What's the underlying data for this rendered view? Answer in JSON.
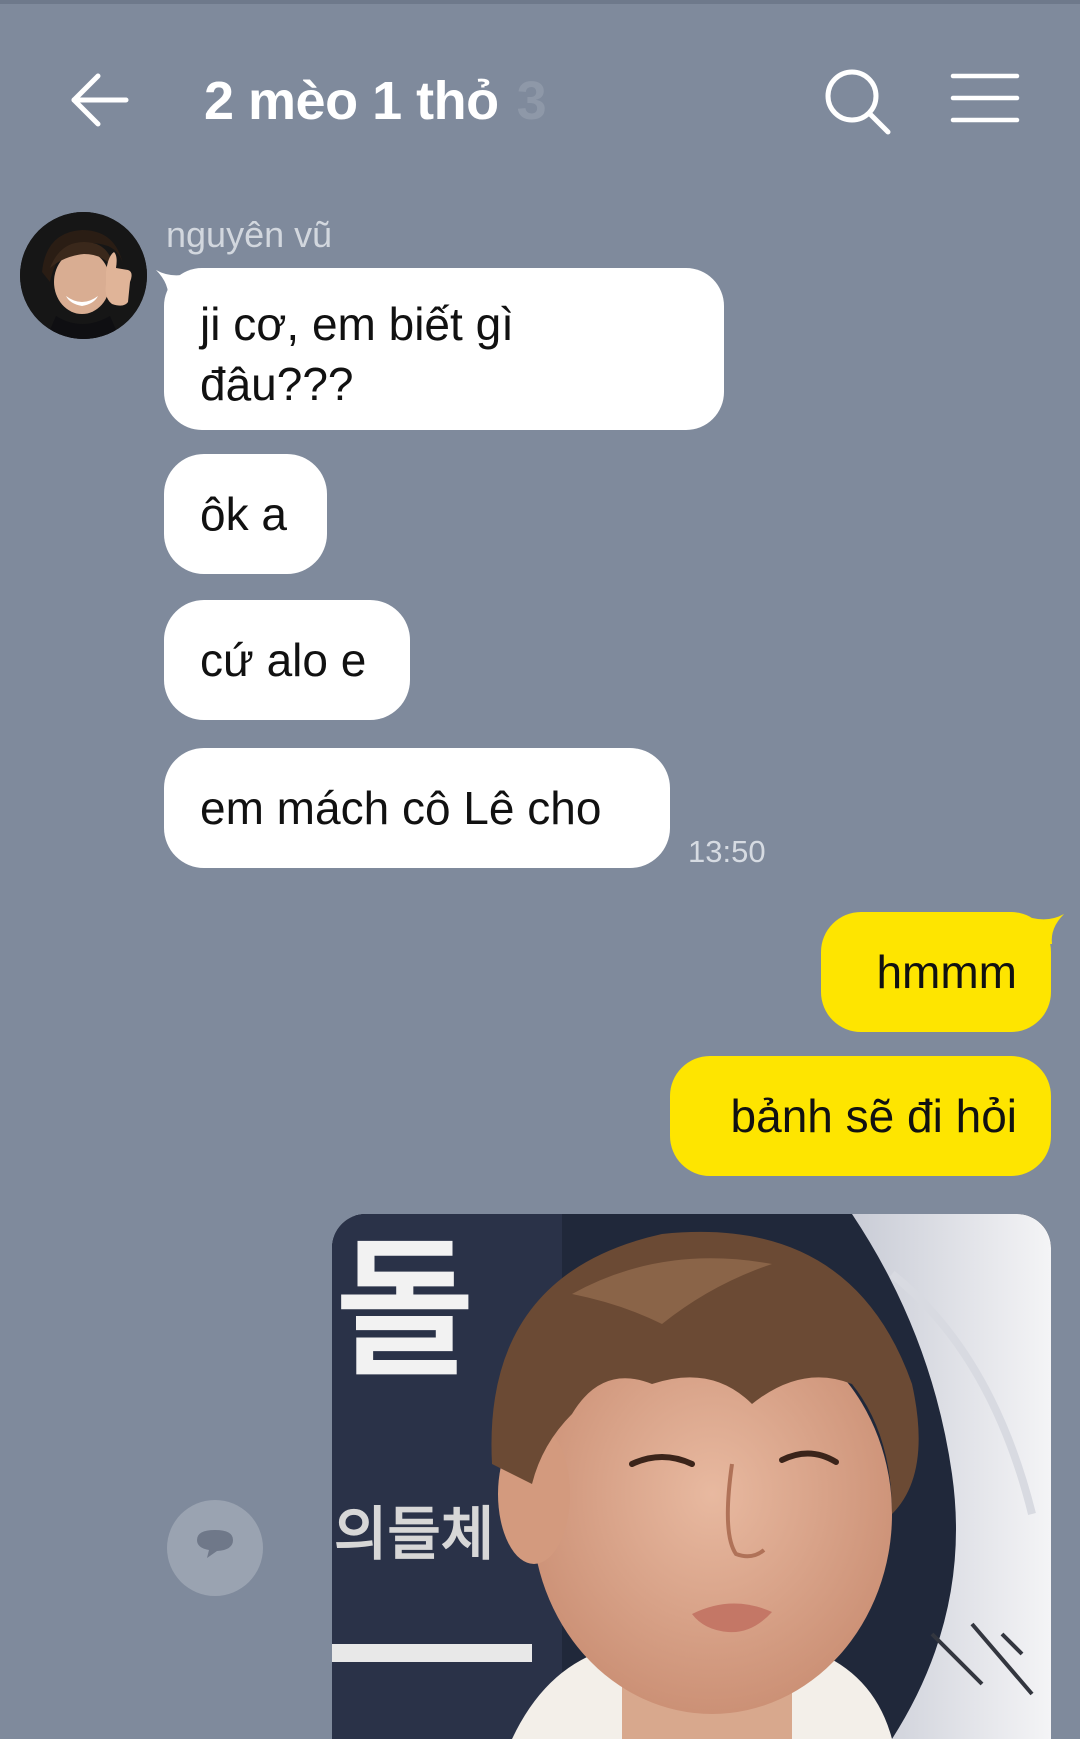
{
  "header": {
    "title": "2 mèo 1 thỏ",
    "member_count": "3",
    "icons": [
      "back-arrow-icon",
      "search-icon",
      "menu-icon"
    ]
  },
  "colors": {
    "background": "#7f8a9c",
    "incoming_bubble": "#ffffff",
    "outgoing_bubble": "#fee500",
    "timestamp": "#d6dbe2"
  },
  "conversation": {
    "sender_name": "nguyên vũ",
    "incoming": [
      {
        "line1": "ji cơ, em biết gì",
        "line2": "đâu???"
      },
      {
        "text": "ôk a"
      },
      {
        "text": "cứ alo e"
      },
      {
        "text": "em mách cô Lê cho"
      }
    ],
    "incoming_time": "13:50",
    "outgoing": [
      {
        "text": "hmmm"
      },
      {
        "text": "bảnh sẽ đi hỏi"
      }
    ]
  },
  "photo_message": {
    "sign_text": "돌",
    "sign_text_small": "의들체"
  },
  "fab": {
    "icon": "chat-bubble-icon"
  }
}
